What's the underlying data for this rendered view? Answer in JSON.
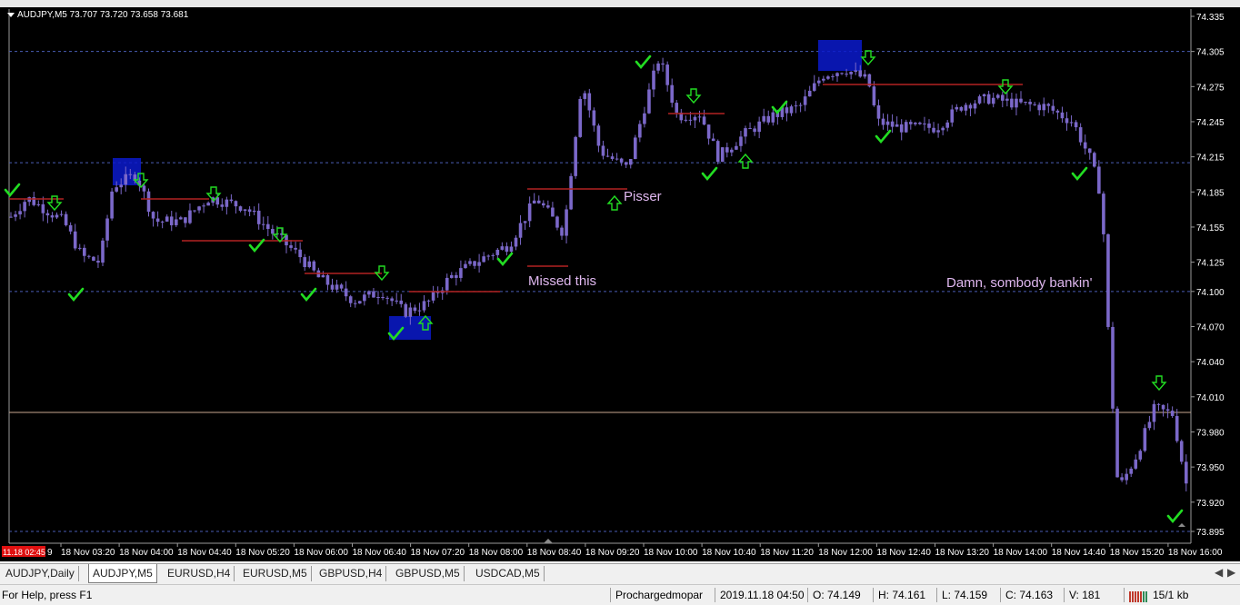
{
  "chart": {
    "header": "AUDJPY,M5  73.707 73.720 73.658 73.681",
    "price_labels": [
      "74.335",
      "74.305",
      "74.275",
      "74.245",
      "74.215",
      "74.185",
      "74.155",
      "74.125",
      "74.100",
      "74.070",
      "74.040",
      "74.010",
      "73.980",
      "73.950",
      "73.920",
      "73.895"
    ],
    "time_labels": [
      "18 Nov 03:20",
      "18 Nov 04:00",
      "18 Nov 04:40",
      "18 Nov 05:20",
      "18 Nov 06:00",
      "18 Nov 06:40",
      "18 Nov 07:20",
      "18 Nov 08:00",
      "18 Nov 08:40",
      "18 Nov 09:20",
      "18 Nov 10:00",
      "18 Nov 10:40",
      "18 Nov 11:20",
      "18 Nov 12:00",
      "18 Nov 12:40",
      "18 Nov 13:20",
      "18 Nov 14:00",
      "18 Nov 14:40",
      "18 Nov 15:20",
      "18 Nov 16:00"
    ],
    "start_time_label": "11.18 02:45",
    "start_time_suffix": "9",
    "annotations": [
      "Pisser",
      "Missed this",
      "Damn, sombody bankin'"
    ],
    "colors": {
      "background": "#000000",
      "candle": "#7b68c9",
      "grid_dashed": "#4a5db5",
      "level_lines": "#b22222",
      "horizontal_line": "#c8a890",
      "annotation_text": "#e0b8f0",
      "check_icon": "#22dd22",
      "arrow_icon": "#22dd22",
      "zone_box": "#0a1acc"
    },
    "icons": [
      "check-icon",
      "down-arrow-icon",
      "up-arrow-icon"
    ]
  },
  "tabs": {
    "items": [
      "AUDJPY,Daily",
      "AUDJPY,M5",
      "EURUSD,H4",
      "EURUSD,M5",
      "GBPUSD,H4",
      "GBPUSD,M5",
      "USDCAD,M5"
    ],
    "active_index": 1,
    "left_arrow": "◀",
    "right_arrow": "▶"
  },
  "status": {
    "help": "For Help, press F1",
    "profile": "Prochargedmopar",
    "datetime": "2019.11.18 04:50",
    "open": "O: 74.149",
    "high": "H: 74.161",
    "low": "L: 74.159",
    "close": "C: 74.163",
    "volume": "V: 181",
    "traffic": "15/1 kb"
  }
}
